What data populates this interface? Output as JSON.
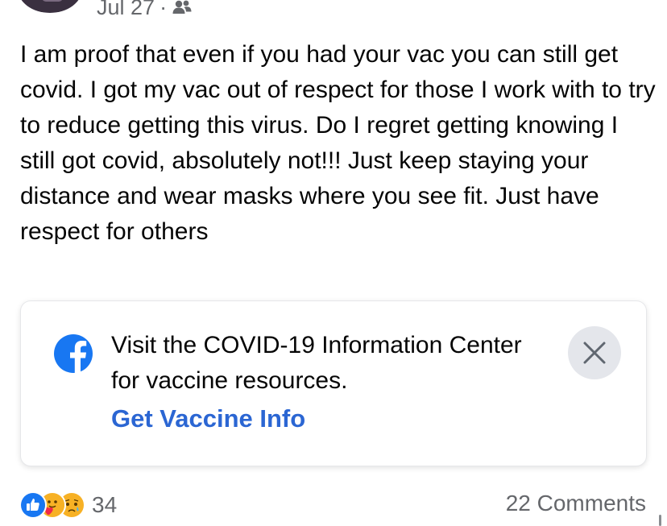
{
  "post": {
    "date": "Jul 27",
    "separator": "·",
    "audience_icon": "friends-icon",
    "text": "I am proof that even if you had your vac you can still get covid. I got my vac out of respect for those I work with to try to reduce getting this virus. Do I regret getting knowing I still got covid, absolutely not!!! Just keep staying your distance and wear masks where you see fit. Just have respect for others"
  },
  "info_card": {
    "icon": "facebook-logo-icon",
    "text": "Visit the COVID-19 Information Center for vaccine resources.",
    "link_label": "Get Vaccine Info",
    "close_icon": "close-icon",
    "link_color": "#2b66d3"
  },
  "footer": {
    "reaction_icons": [
      "like-icon",
      "care-icon",
      "sad-icon"
    ],
    "reaction_count": "34",
    "comments": "22 Comments"
  }
}
